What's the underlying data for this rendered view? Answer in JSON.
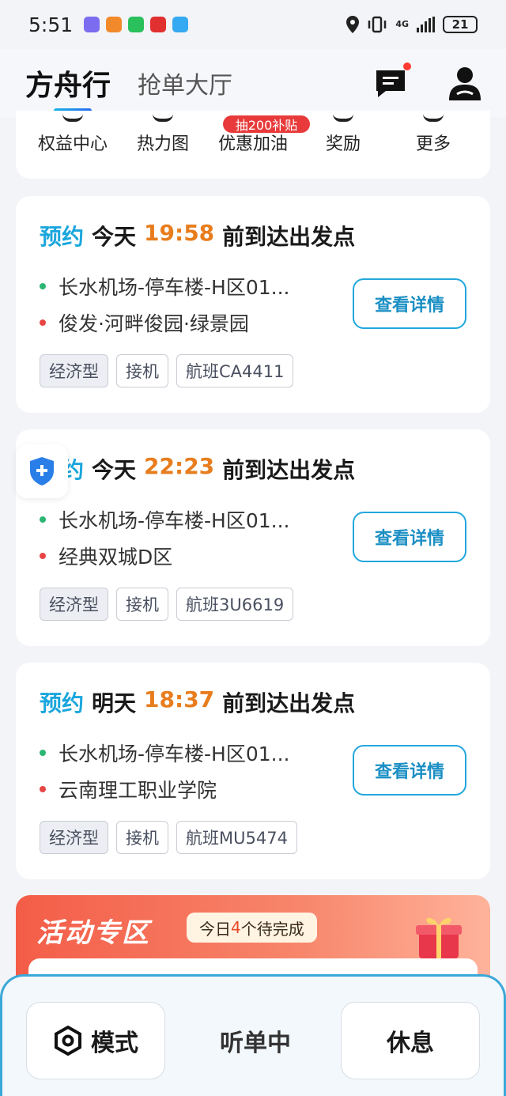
{
  "status_bar": {
    "time": "5:51",
    "network": "4G",
    "battery": "21"
  },
  "header": {
    "tab_active": "方舟行",
    "tab_other": "抢单大厅"
  },
  "shortcuts": {
    "promo_badge": "抽200补贴",
    "items": [
      {
        "label": "权益中心"
      },
      {
        "label": "热力图"
      },
      {
        "label": "优惠加油"
      },
      {
        "label": "奖励"
      },
      {
        "label": "更多"
      }
    ]
  },
  "orders": [
    {
      "reserve": "预约",
      "day": "今天",
      "time": "19:58",
      "suffix": "前到达出发点",
      "from": "长水机场-停车楼-H区01...",
      "to": "俊发·河畔俊园·绿景园",
      "button": "查看详情",
      "tags": [
        "经济型",
        "接机",
        "航班CA4411"
      ]
    },
    {
      "reserve": "预约",
      "day": "今天",
      "time": "22:23",
      "suffix": "前到达出发点",
      "from": "长水机场-停车楼-H区01...",
      "to": "经典双城D区",
      "button": "查看详情",
      "tags": [
        "经济型",
        "接机",
        "航班3U6619"
      ]
    },
    {
      "reserve": "预约",
      "day": "明天",
      "time": "18:37",
      "suffix": "前到达出发点",
      "from": "长水机场-停车楼-H区01...",
      "to": "云南理工职业学院",
      "button": "查看详情",
      "tags": [
        "经济型",
        "接机",
        "航班MU5474"
      ]
    }
  ],
  "activity": {
    "title": "活动专区",
    "chip_prefix": "今日",
    "chip_count": "4",
    "chip_suffix": "个待完成"
  },
  "bottom": {
    "mode": "模式",
    "listening": "听单中",
    "rest": "休息"
  },
  "colors": {
    "accent_blue": "#1aa6dc",
    "time_orange": "#e87d1e",
    "badge_red": "#e83a3a"
  }
}
